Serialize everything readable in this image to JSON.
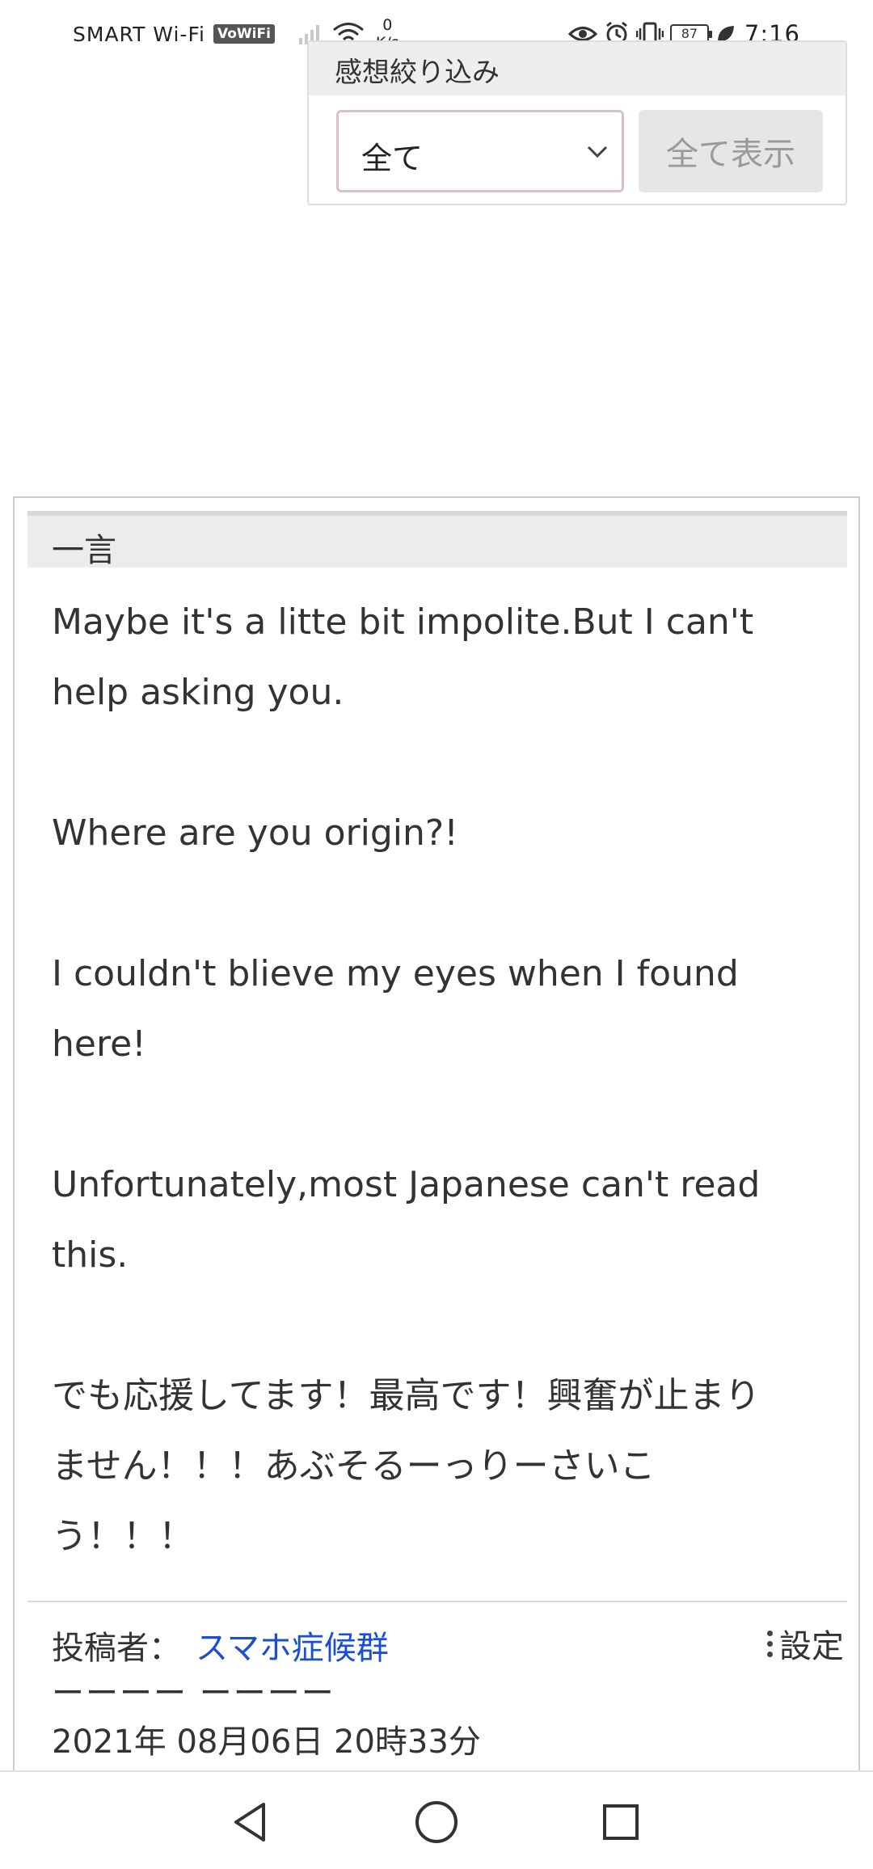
{
  "status_bar": {
    "carrier": "SMART Wi-Fi",
    "vowifi_badge": "VoWiFi",
    "net_speed_value": "0",
    "net_speed_unit": "K/s",
    "battery_level": "87",
    "time": "7:16",
    "icons": [
      "signal-icon",
      "wifi-icon",
      "eye-icon",
      "alarm-icon",
      "vibrate-icon",
      "battery-icon",
      "leaf-icon"
    ]
  },
  "filter": {
    "title": "感想絞り込み",
    "select_value": "全て",
    "show_all_label": "全て表示"
  },
  "comment": {
    "header_title": "一言",
    "lines": [
      "Maybe it's a litte bit impolite.But I can't",
      "help asking you.",
      "",
      "Where are you origin?!",
      "",
      "I couldn't blieve my eyes when I found",
      "here!",
      "",
      "Unfortunately,most Japanese can't read",
      "this.",
      "",
      "でも応援してます！最高です！興奮が止まり",
      "ません！！！あぶそるーっりーさいこ",
      "う！！！"
    ],
    "poster_label": "投稿者：",
    "poster_name": "スマホ症候群",
    "settings_label": "設定",
    "dash_line": "ーーーー ーーーー",
    "date": "2021年 08月06日 20時33分"
  },
  "nav_bar": {
    "icons": [
      "back-icon",
      "home-icon",
      "recent-apps-icon"
    ]
  },
  "colors": {
    "link": "#1a4fcf",
    "header_bg": "#ececec",
    "button_bg": "#e6e6e6",
    "select_border": "#d9c2c2"
  }
}
